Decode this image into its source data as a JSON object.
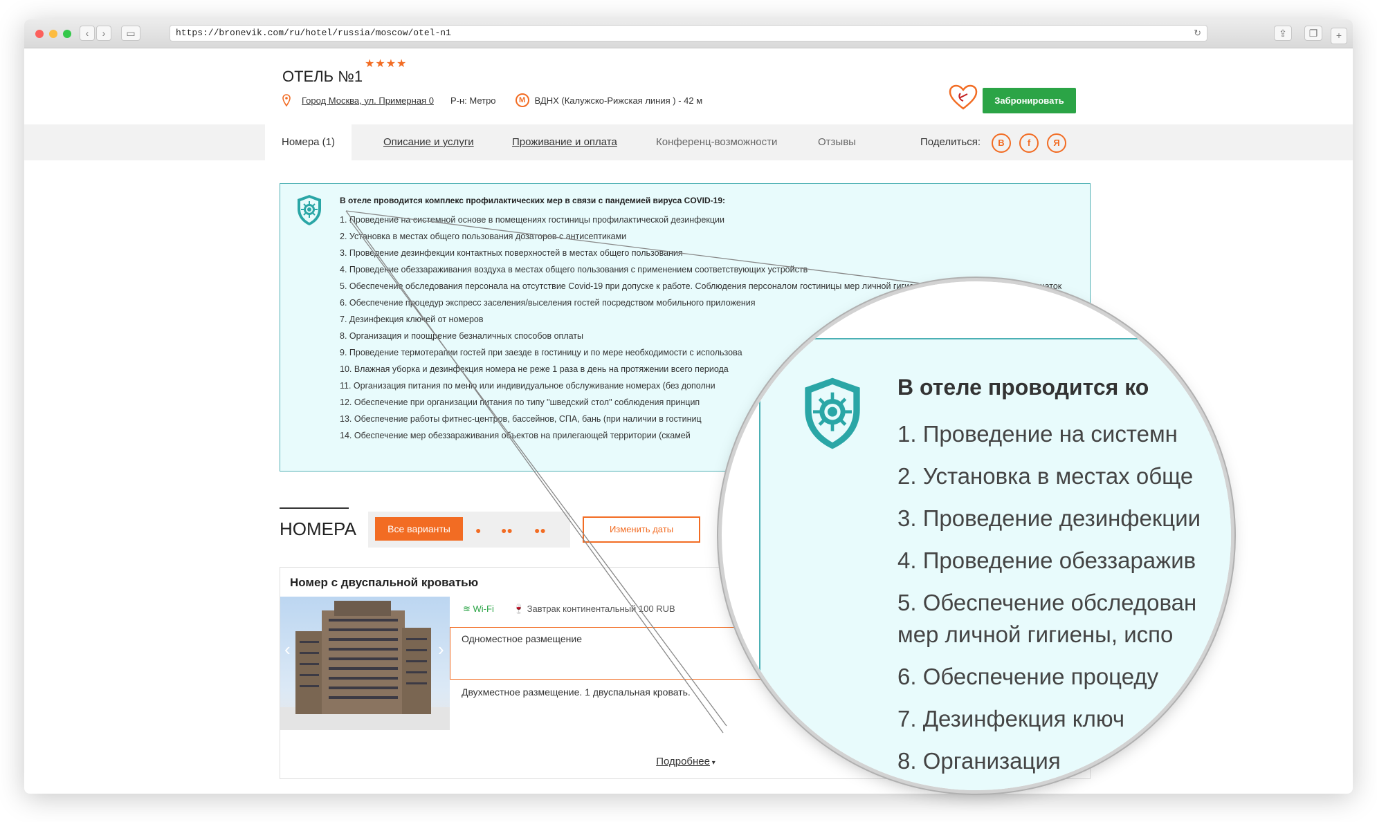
{
  "browser": {
    "url": "https://bronevik.com/ru/hotel/russia/moscow/otel-n1",
    "colors": {
      "close": "#fc605c",
      "minimize": "#fdbc40",
      "maximize": "#34c84a"
    }
  },
  "hotel": {
    "name": "ОТЕЛЬ №1",
    "stars": "★★★★",
    "address": "Город Москва, ул. Примерная 0",
    "district": "Р-н: Метро",
    "metro_icon": "М",
    "metro": "ВДНХ (Калужско-Рижская линия ) - 42 м",
    "book_label": "Забронировать"
  },
  "tabs": [
    {
      "label": "Номера (1)"
    },
    {
      "label": "Описание и услуги"
    },
    {
      "label": "Проживание и оплата"
    },
    {
      "label": "Конференц-возможности"
    },
    {
      "label": "Отзывы"
    }
  ],
  "share": {
    "label": "Поделиться:",
    "icons": [
      "В",
      "f",
      "Я"
    ]
  },
  "covid": {
    "title": "В отеле проводится комплекс профилактических мер в связи с пандемией вируса COVID-19:",
    "items": [
      "1. Проведение на системной основе в помещениях гостиницы профилактической дезинфекции",
      "2. Установка в местах общего пользования дозаторов с антисептиками",
      "3. Проведение дезинфекции контактных поверхностей в местах общего пользования",
      "4. Проведение обеззараживания воздуха в местах общего пользования с применением соответствующих устройств",
      "5. Обеспечение обследования персонала на отсутствие Covid-19 при допуске к работе. Соблюдения персоналом гостиницы мер личной гигиены, использования масок и перчаток",
      "6. Обеспечение процедур экспресс заселения/выселения гостей посредством мобильного приложения",
      "7. Дезинфекция ключей от номеров",
      "8. Организация и поощрение безналичных способов оплаты",
      "9. Проведение термотерапии гостей при заезде в гостиницу и по мере необходимости с использова",
      "10. Влажная уборка и дезинфекция номера не реже 1 раза в день на протяжении всего периода",
      "11. Организация питания по меню или индивидуальное обслуживание номерах (без дополни",
      "12. Обеспечение при организации питания по типу \"шведский стол\"  соблюдения принцип",
      "13. Обеспечение работы фитнес-центров, бассейнов, СПА, бань (при наличии в гостиниц",
      "14. Обеспечение мер обеззараживания объектов на прилегающей территории (скамей"
    ]
  },
  "rooms": {
    "title": "НОМЕРА",
    "filter_all": "Все варианты",
    "change_dates": "Изменить даты",
    "card": {
      "name": "Номер с двуспальной кроватью",
      "wifi": "Wi-Fi",
      "breakfast": "Завтрак континентальный 100 RUB",
      "option1": "Одноместное размещение",
      "option2": "Двухместное размещение. 1 двуспальная кровать.",
      "more": "Подробнее"
    }
  },
  "magnifier": {
    "title": "В отеле проводится ко",
    "items": [
      "1. Проведение на системн",
      "2. Установка в местах обще",
      "3. Проведение дезинфекции",
      "4. Проведение обеззаражив",
      "5. Обеспечение обследован",
      "мер личной гигиены, испо",
      "6. Обеспечение процеду",
      "7. Дезинфекция ключ",
      "8. Организация"
    ]
  }
}
